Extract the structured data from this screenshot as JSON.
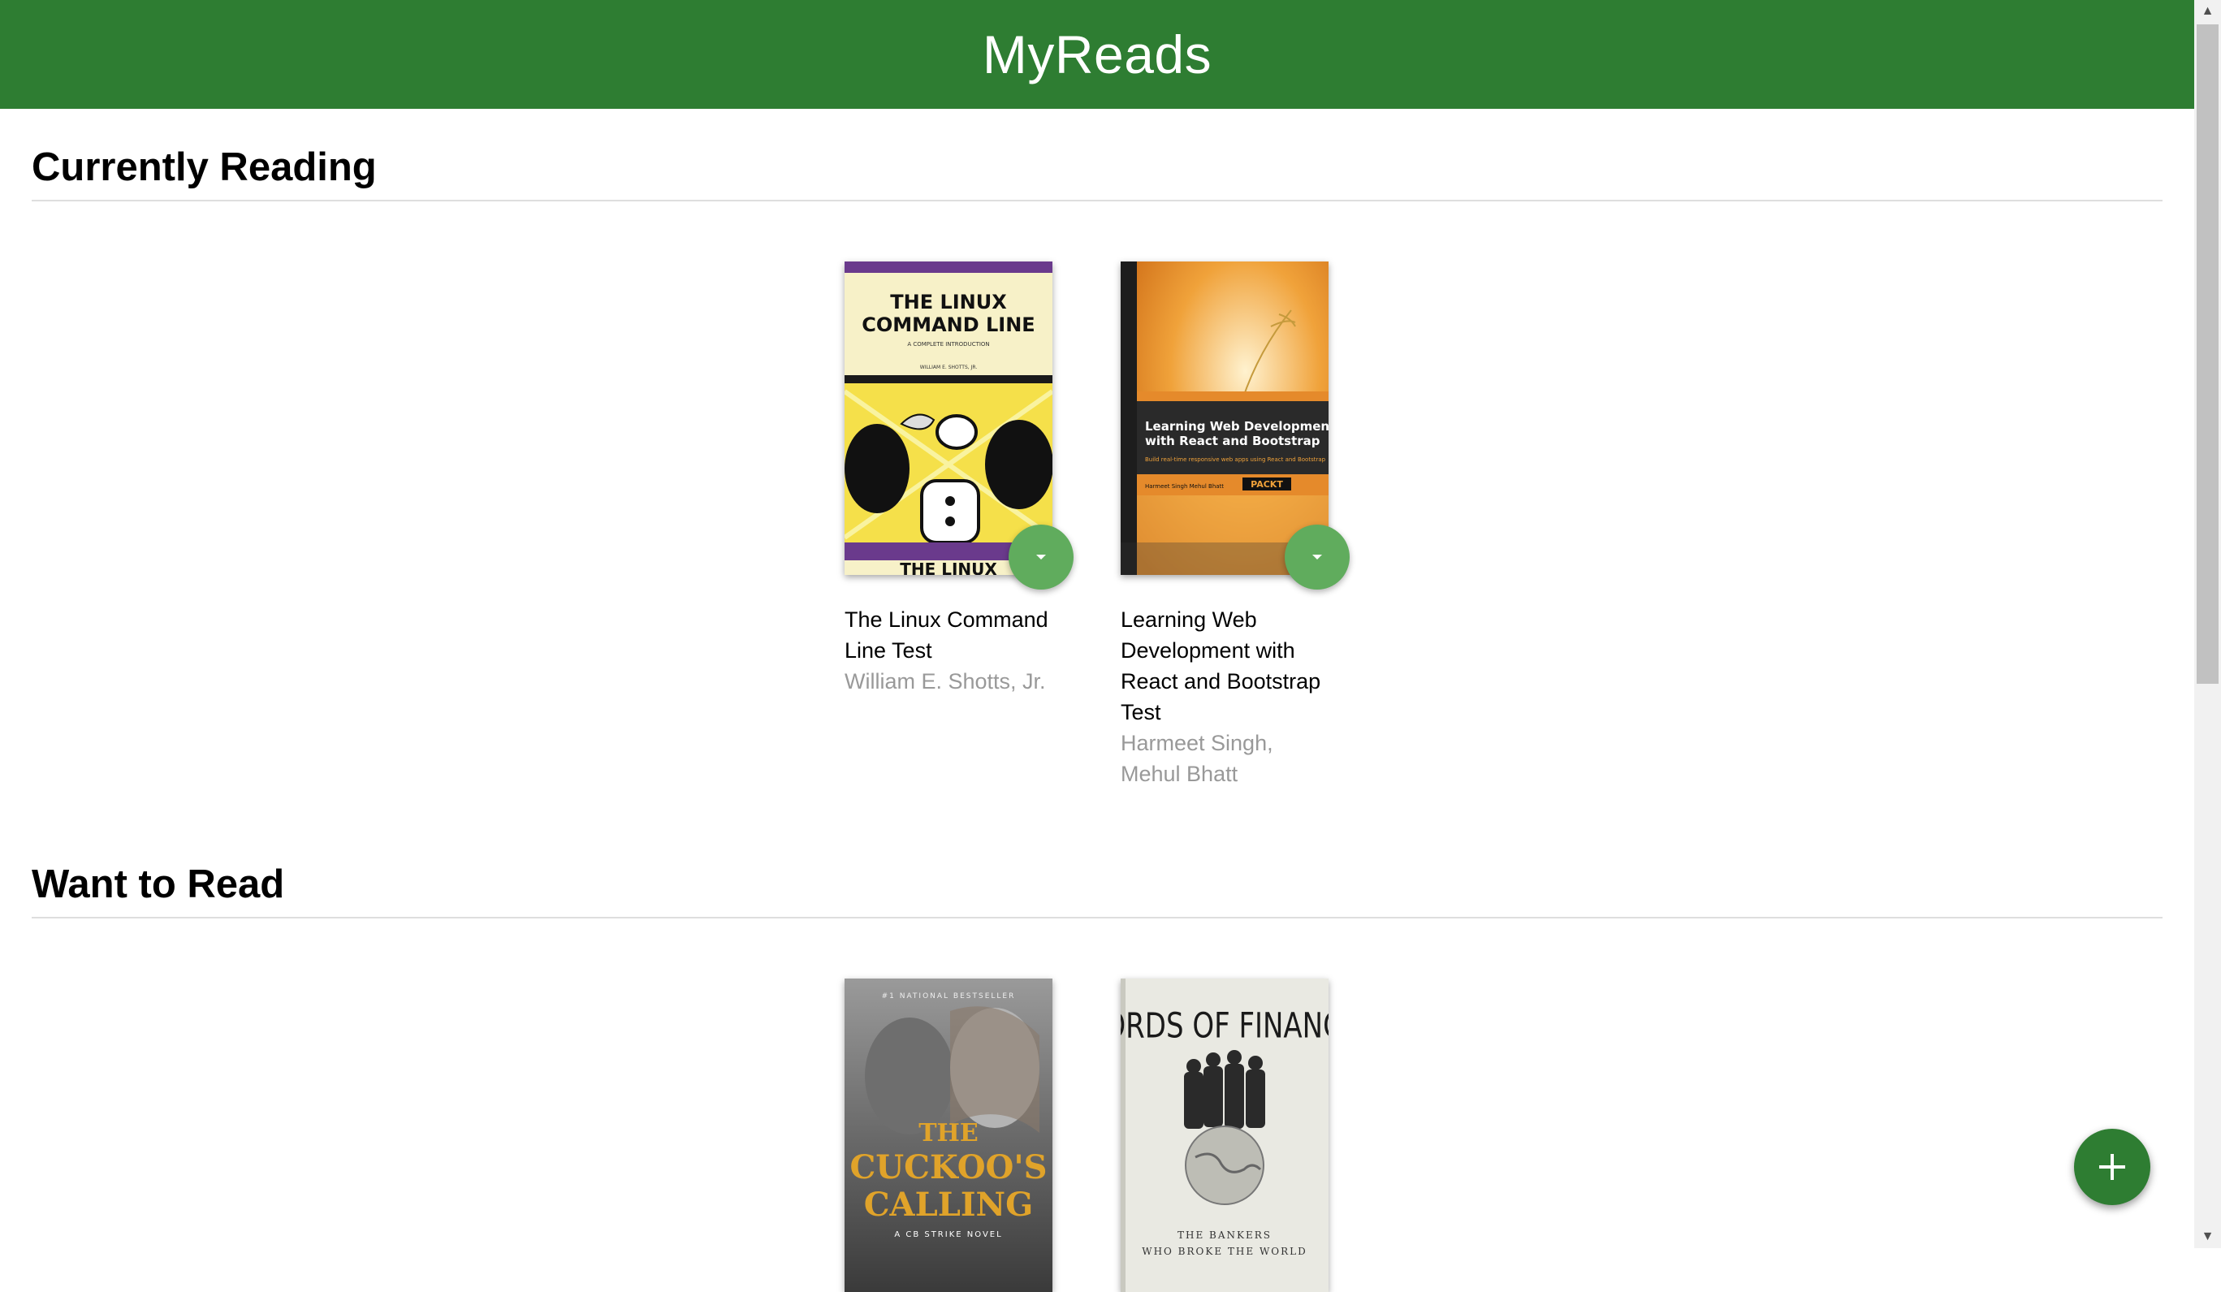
{
  "app": {
    "title": "MyReads"
  },
  "shelves": [
    {
      "title": "Currently Reading",
      "books": [
        {
          "title": "The Linux Command Line Test",
          "authors": "William E. Shotts, Jr.",
          "cover": {
            "heading": "THE LINUX COMMAND LINE",
            "subtitle": "A COMPLETE INTRODUCTION",
            "author": "WILLIAM E. SHOTTS, JR.",
            "footer": "THE LINUX"
          }
        },
        {
          "title": "Learning Web Development with React and Bootstrap Test",
          "authors": "Harmeet Singh, Mehul Bhatt",
          "cover": {
            "heading": "Learning Web Development with React and Bootstrap",
            "subtitle": "Build real-time responsive web apps using React and Bootstrap",
            "author": "Harmeet Singh Mehul Bhatt",
            "publisher": "PACKT"
          }
        }
      ]
    },
    {
      "title": "Want to Read",
      "books": [
        {
          "title": "",
          "authors": "",
          "cover": {
            "banner": "#1 NATIONAL BESTSELLER",
            "heading": "THE CUCKOO'S CALLING",
            "subtitle": "A CB STRIKE NOVEL"
          }
        },
        {
          "title": "",
          "authors": "",
          "cover": {
            "heading": "LORDS OF FINANCE",
            "subtitle": "THE BANKERS WHO BROKE THE WORLD"
          }
        }
      ]
    }
  ],
  "colors": {
    "header": "#2e7d32",
    "shelf_button": "#60ac5d",
    "fab": "#2e7d32"
  },
  "icons": {
    "shelf_changer": "arrow-drop-down-icon",
    "add_book": "plus-icon"
  }
}
